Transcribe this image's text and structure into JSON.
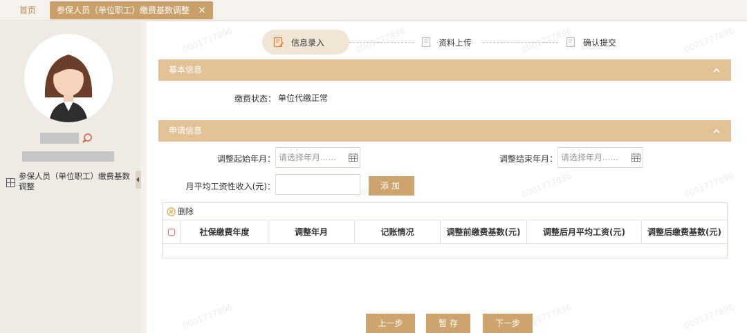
{
  "tabs": {
    "home": "首页",
    "active": "参保人员（单位职工）缴费基数调整",
    "close": "×"
  },
  "sidebar": {
    "menu_item": "参保人员（单位职工）缴费基数调整"
  },
  "steps": [
    {
      "label": "信息录入",
      "active": true
    },
    {
      "label": "资料上传",
      "active": false
    },
    {
      "label": "确认提交",
      "active": false
    }
  ],
  "basic_info": {
    "title": "基本信息",
    "status_label": "缴费状态：",
    "status_value": "单位代缴正常"
  },
  "apply_info": {
    "title": "申请信息",
    "start_label": "调整起始年月：",
    "start_placeholder": "请选择年月......",
    "end_label": "调整结束年月：",
    "end_placeholder": "请选择年月......",
    "income_label": "月平均工资性收入(元)：",
    "income_value": "",
    "add_button": "添加"
  },
  "table": {
    "delete_label": "删除",
    "columns": [
      "社保缴费年度",
      "调整年月",
      "记账情况",
      "调整前缴费基数(元)",
      "调整后月平均工资(元)",
      "调整后缴费基数(元)"
    ],
    "rows": []
  },
  "buttons": {
    "prev": "上一步",
    "save": "暂 存",
    "next": "下一步"
  },
  "watermark": "0001777896",
  "colors": {
    "accent": "#caa06a",
    "section_header": "#e2c296",
    "step_active_bg": "#f1e6d5"
  }
}
